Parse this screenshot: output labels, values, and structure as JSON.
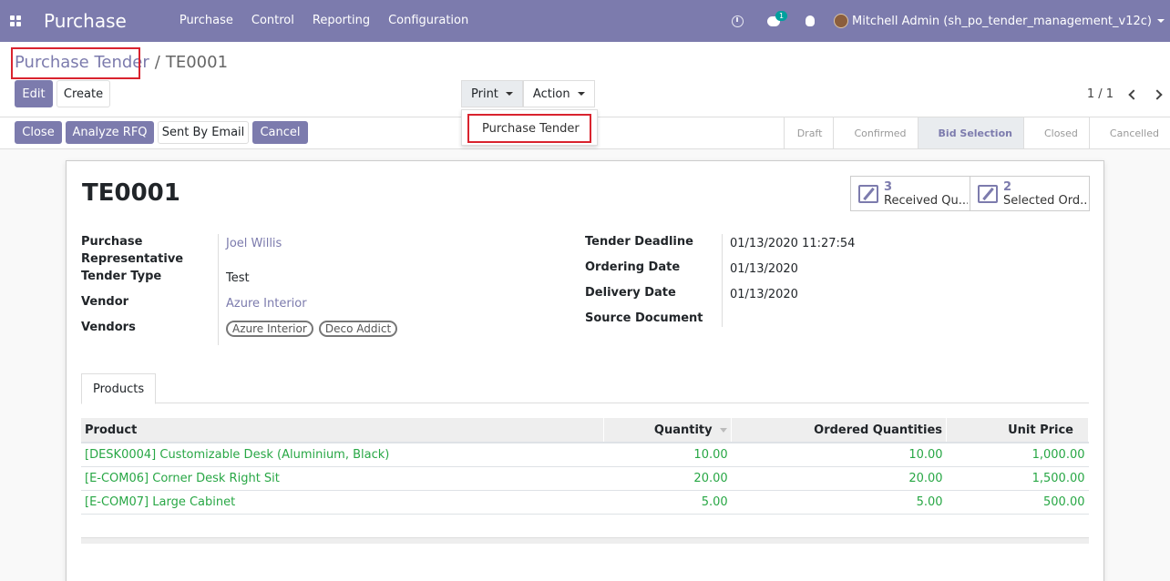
{
  "navbar": {
    "brand": "Purchase",
    "menu": [
      "Purchase",
      "Control",
      "Reporting",
      "Configuration"
    ],
    "chat_badge": "1",
    "user_name": "Mitchell Admin (sh_po_tender_management_v12c)"
  },
  "breadcrumb": {
    "parent": "Purchase Tender",
    "separator": "/",
    "current": "TE0001"
  },
  "toolbar": {
    "edit": "Edit",
    "create": "Create",
    "print": "Print",
    "action": "Action",
    "pager": "1 / 1"
  },
  "print_menu": {
    "item": "Purchase Tender"
  },
  "status_buttons": [
    "Close",
    "Analyze RFQ",
    "Sent By Email",
    "Cancel"
  ],
  "stages": [
    {
      "label": "Draft"
    },
    {
      "label": "Confirmed"
    },
    {
      "label": "Bid Selection",
      "current": true
    },
    {
      "label": "Closed"
    },
    {
      "label": "Cancelled"
    }
  ],
  "record": {
    "title": "TE0001",
    "smart_buttons": [
      {
        "count": "3",
        "label": "Received Qu..."
      },
      {
        "count": "2",
        "label": "Selected Ord..."
      }
    ],
    "left_fields": {
      "rep_label_1": "Purchase",
      "rep_label_2": "Representative",
      "rep_value": "Joel Willis",
      "type_label": "Tender Type",
      "type_value": "Test",
      "vendor_label": "Vendor",
      "vendor_value": "Azure Interior",
      "vendors_label": "Vendors",
      "vendors_tags": [
        "Azure Interior",
        "Deco Addict"
      ]
    },
    "right_fields": {
      "deadline_label": "Tender Deadline",
      "deadline_value": "01/13/2020 11:27:54",
      "ordering_label": "Ordering Date",
      "ordering_value": "01/13/2020",
      "delivery_label": "Delivery Date",
      "delivery_value": "01/13/2020",
      "source_label": "Source Document",
      "source_value": ""
    },
    "tab": "Products",
    "table": {
      "headers": [
        "Product",
        "Quantity",
        "Ordered Quantities",
        "Unit Price"
      ],
      "rows": [
        [
          "[DESK0004] Customizable Desk (Aluminium, Black)",
          "10.00",
          "10.00",
          "1,000.00"
        ],
        [
          "[E-COM06] Corner Desk Right Sit",
          "20.00",
          "20.00",
          "1,500.00"
        ],
        [
          "[E-COM07] Large Cabinet",
          "5.00",
          "5.00",
          "500.00"
        ]
      ]
    }
  },
  "colors": {
    "primary": "#7c7bad",
    "highlight": "#d9232e",
    "product_text": "#28a745"
  }
}
